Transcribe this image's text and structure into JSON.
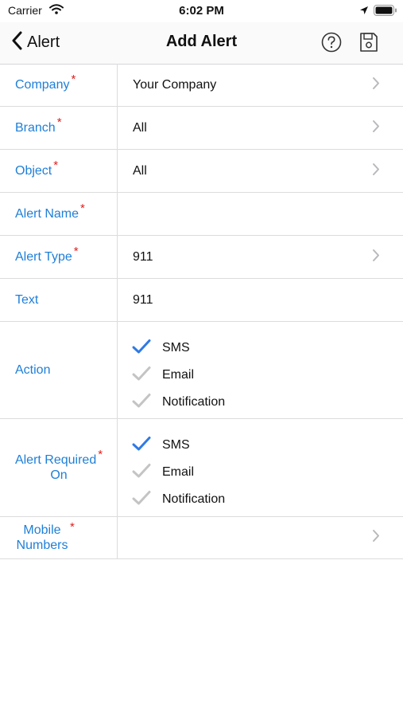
{
  "status": {
    "carrier": "Carrier",
    "time": "6:02 PM"
  },
  "nav": {
    "back_label": "Alert",
    "title": "Add Alert"
  },
  "form": {
    "company": {
      "label": "Company",
      "value": "Your Company"
    },
    "branch": {
      "label": "Branch",
      "value": "All"
    },
    "object": {
      "label": "Object",
      "value": "All"
    },
    "alert_name": {
      "label": "Alert Name",
      "value": ""
    },
    "alert_type": {
      "label": "Alert Type",
      "value": "911"
    },
    "text": {
      "label": "Text",
      "value": "911"
    },
    "action": {
      "label": "Action",
      "options": [
        {
          "label": "SMS",
          "checked": true
        },
        {
          "label": "Email",
          "checked": false
        },
        {
          "label": "Notification",
          "checked": false
        }
      ]
    },
    "alert_required_on": {
      "label_line1": "Alert Required",
      "label_line2": "On",
      "options": [
        {
          "label": "SMS",
          "checked": true
        },
        {
          "label": "Email",
          "checked": false
        },
        {
          "label": "Notification",
          "checked": false
        }
      ]
    },
    "mobile_numbers": {
      "label_line1": "Mobile",
      "label_line2": "Numbers",
      "value": ""
    },
    "required_mark": "*"
  },
  "colors": {
    "label_blue": "#1e7fd8",
    "required_red": "#e0201f",
    "check_active": "#2f7ae5",
    "check_inactive": "#c4c4c4"
  },
  "icons": [
    "wifi-icon",
    "location-arrow-icon",
    "battery-icon",
    "back-chevron-icon",
    "help-icon",
    "save-icon",
    "chevron-right-icon",
    "checkmark-icon"
  ]
}
